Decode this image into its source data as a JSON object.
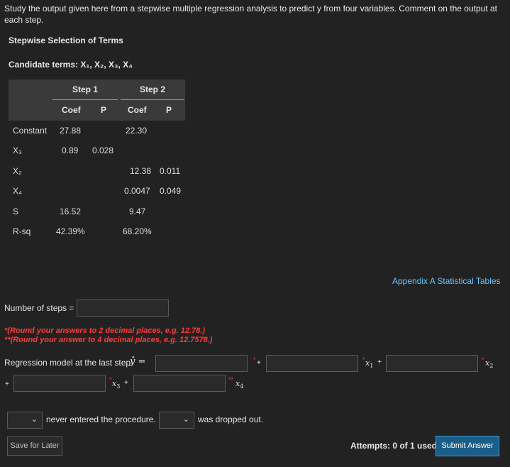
{
  "prompt": "Study the output given here from a stepwise multiple regression analysis to predict y from four variables. Comment on the output at each step.",
  "section_title": "Stepwise Selection of Terms",
  "candidate_terms": "Candidate terms: X₁, X₂, X₃, X₄",
  "table": {
    "step1": "Step 1",
    "step2": "Step 2",
    "coef": "Coef",
    "p": "P",
    "rows": [
      {
        "label": "Constant",
        "s1c": "27.88",
        "s1p": "",
        "s2c": "22.30",
        "s2p": ""
      },
      {
        "label": "X₃",
        "s1c": "0.89",
        "s1p": "0.028",
        "s2c": "",
        "s2p": ""
      },
      {
        "label": "X₂",
        "s1c": "",
        "s1p": "",
        "s2c": "12.38",
        "s2p": "0.011"
      },
      {
        "label": "X₄",
        "s1c": "",
        "s1p": "",
        "s2c": "0.0047",
        "s2p": "0.049"
      },
      {
        "label": "S",
        "s1c": "16.52",
        "s1p": "",
        "s2c": "9.47",
        "s2p": ""
      },
      {
        "label": "R-sq",
        "s1c": "42.39%",
        "s1p": "",
        "s2c": "68.20%",
        "s2p": ""
      }
    ]
  },
  "appendix_link": "Appendix A Statistical Tables",
  "steps_label": "Number of steps =",
  "steps_value": "",
  "warn1": "*(Round your answers to 2 decimal places, e.g. 12.78.)",
  "warn2": "**(Round your answer to 4 decimal places, e.g. 12.7578.)",
  "model_label": "Regression model at the last step:",
  "yhat": "ŷ =",
  "star1": "*",
  "star2": "**",
  "plus": "+",
  "x1": "x",
  "x1_sub": "1",
  "x2": "x",
  "x2_sub": "2",
  "x3": "x",
  "x3_sub": "3",
  "x4": "x",
  "x4_sub": "4",
  "never_entered": "never entered the procedure.",
  "dropped_out": "was dropped out.",
  "chevron": "⌄",
  "save_label": "Save for Later",
  "attempts": "Attempts: 0 of 1 used",
  "submit_label": "Submit Answer"
}
